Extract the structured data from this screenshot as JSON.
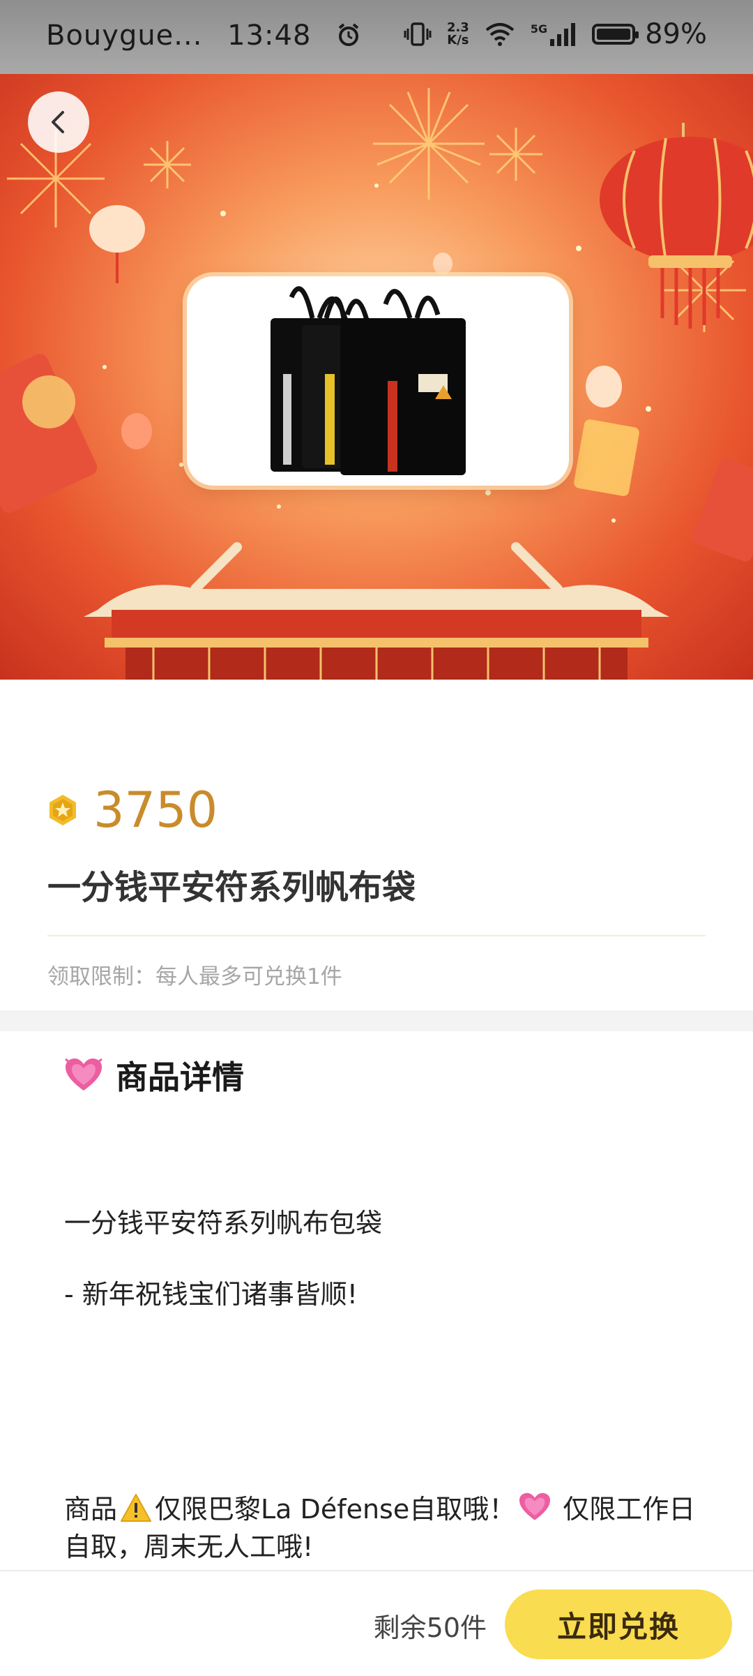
{
  "status_bar": {
    "carrier": "Bouygue...",
    "time": "13:48",
    "net_speed_value": "2.3",
    "net_speed_unit": "K/s",
    "network": "5G",
    "battery": "89%",
    "icons": [
      "alarm-icon",
      "vibrate-icon",
      "wifi-icon",
      "signal-icon",
      "battery-icon"
    ]
  },
  "product": {
    "points": "3750",
    "title": "一分钱平安符系列帆布袋",
    "limit": "领取限制：每人最多可兑换1件"
  },
  "details": {
    "heading": "商品详情",
    "line1": "一分钱平安符系列帆布包袋",
    "line2": "- 新年祝钱宝们诸事皆顺!",
    "line3_a": "商品",
    "line3_b": "仅限巴黎La Défense自取哦！",
    "line3_c": " 仅限工作日自取，周末无人工哦!"
  },
  "footer": {
    "remaining": "剩余50件",
    "redeem_label": "立即兑换"
  },
  "colors": {
    "accent_gold": "#c98b2b",
    "button_yellow": "#f9dc4f",
    "banner_red": "#e8552e"
  }
}
